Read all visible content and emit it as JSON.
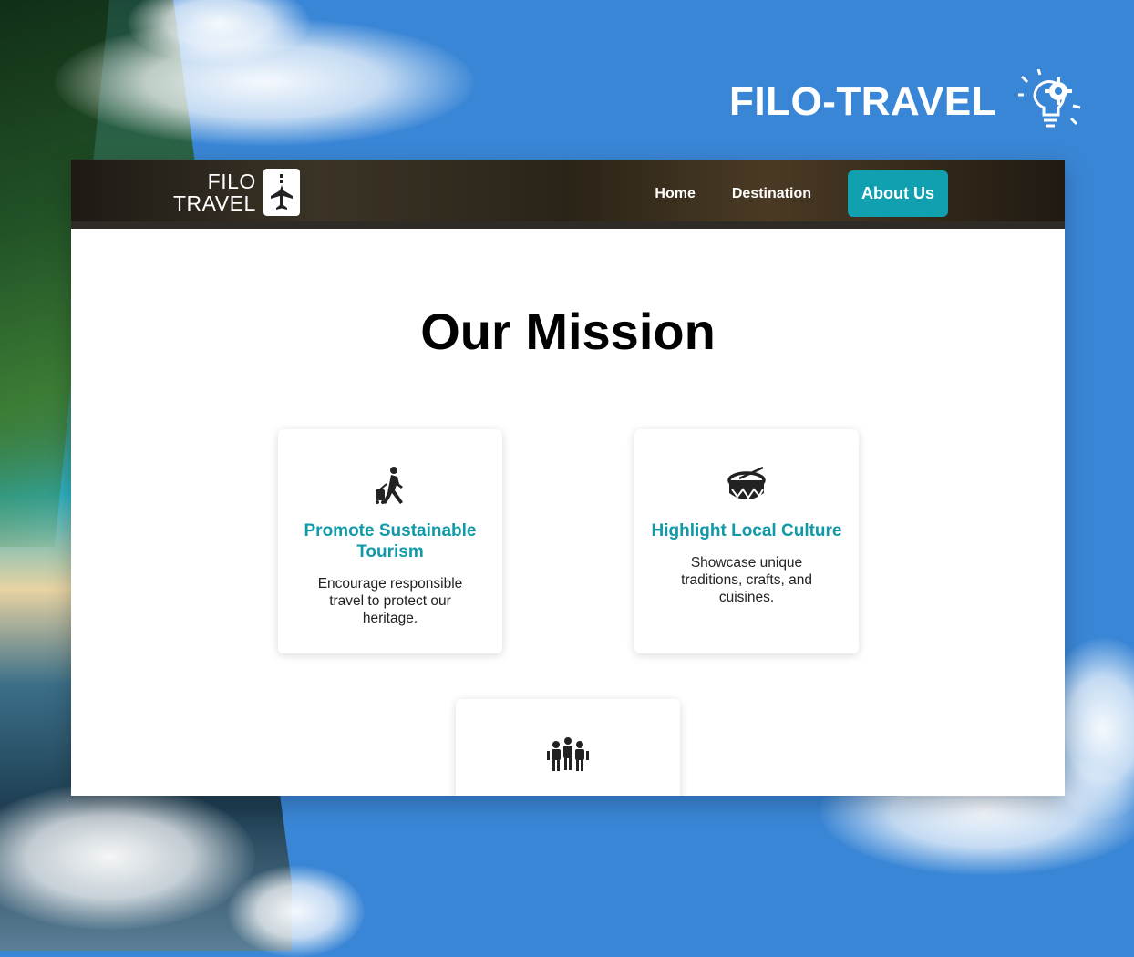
{
  "brand": {
    "name": "FILO-TRAVEL",
    "icon": "lightbulb-gear-icon"
  },
  "site": {
    "logo": {
      "line1": "FILO",
      "line2": "TRAVEL",
      "icon": "airplane-badge-icon"
    },
    "nav": [
      {
        "label": "Home",
        "active": false
      },
      {
        "label": "Destination",
        "active": false
      },
      {
        "label": "About Us",
        "active": true
      }
    ],
    "accent_color": "#11a0b0",
    "mission": {
      "title": "Our Mission",
      "cards": [
        {
          "icon": "traveler-with-luggage-icon",
          "title": "Promote Sustainable Tourism",
          "text": "Encourage responsible travel to protect our heritage."
        },
        {
          "icon": "drum-icon",
          "title": "Highlight Local Culture",
          "text": "Showcase unique traditions, crafts, and cuisines."
        },
        {
          "icon": "community-people-icon",
          "title": "",
          "text": ""
        }
      ]
    }
  }
}
